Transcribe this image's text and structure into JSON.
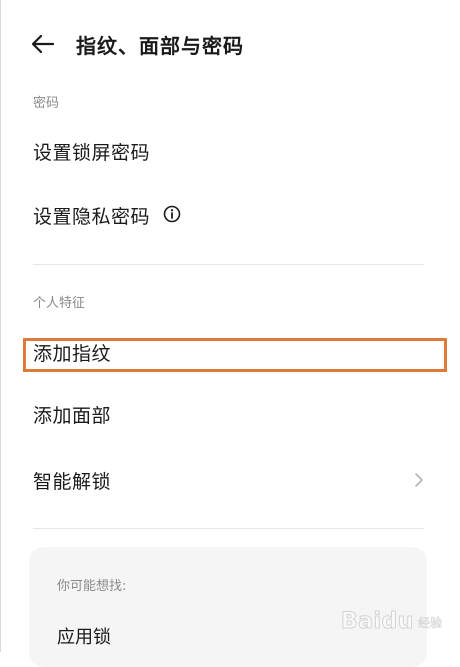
{
  "header": {
    "title": "指纹、面部与密码",
    "back_icon": "back-arrow-icon"
  },
  "sections": {
    "password": {
      "label": "密码",
      "items": [
        "设置锁屏密码",
        "设置隐私密码"
      ]
    },
    "personal": {
      "label": "个人特征",
      "items": [
        "添加指纹",
        "添加面部",
        "智能解锁"
      ]
    }
  },
  "suggestions": {
    "title": "你可能想找:",
    "items": [
      "应用锁"
    ]
  },
  "watermark": {
    "text": "Baidu",
    "sub": "经验"
  },
  "colors": {
    "highlight": "#e07a3a",
    "card_bg": "#f5f5f5",
    "muted_text": "#8a8a8a"
  }
}
